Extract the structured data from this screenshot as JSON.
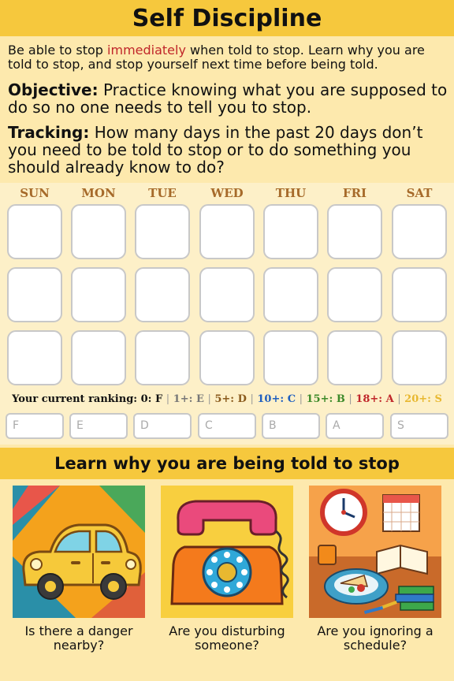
{
  "title": "Self Discipline",
  "description": {
    "before": "Be able to stop ",
    "highlight": "immediately",
    "after": " when told to stop. Learn why you are told to stop, and stop yourself next time before being told."
  },
  "objective": {
    "label": "Objective:",
    "text": " Practice knowing what you are supposed to do so no one needs to tell you to stop."
  },
  "tracking": {
    "label": "Tracking:",
    "text": " How many days in the past 20 days don’t you need to be told to stop or to do something you should already know to do?"
  },
  "days": [
    "SUN",
    "MON",
    "TUE",
    "WED",
    "THU",
    "FRI",
    "SAT"
  ],
  "ranking": {
    "label": "Your current ranking:",
    "tiers": [
      {
        "threshold": "0:",
        "grade": "F",
        "color": "#111111"
      },
      {
        "threshold": "1+:",
        "grade": "E",
        "color": "#777777"
      },
      {
        "threshold": "5+:",
        "grade": "D",
        "color": "#8a5a1c"
      },
      {
        "threshold": "10+:",
        "grade": "C",
        "color": "#1f5fbf"
      },
      {
        "threshold": "15+:",
        "grade": "B",
        "color": "#3d8a2a"
      },
      {
        "threshold": "18+:",
        "grade": "A",
        "color": "#c0262a"
      },
      {
        "threshold": "20+:",
        "grade": "S",
        "color": "#e8b830"
      }
    ],
    "boxes": [
      "F",
      "E",
      "D",
      "C",
      "B",
      "A",
      "S"
    ]
  },
  "learn": {
    "title": "Learn why you are being told to stop",
    "cards": [
      {
        "icon": "car-icon",
        "caption": "Is there a danger nearby?"
      },
      {
        "icon": "telephone-icon",
        "caption": "Are you disturbing someone?"
      },
      {
        "icon": "clock-calendar-icon",
        "caption": "Are you ignoring a schedule?"
      }
    ]
  },
  "colors": {
    "banner": "#f6c83d",
    "background": "#fde9ad",
    "highlight": "#c0262a",
    "day_header": "#a66a2a"
  }
}
